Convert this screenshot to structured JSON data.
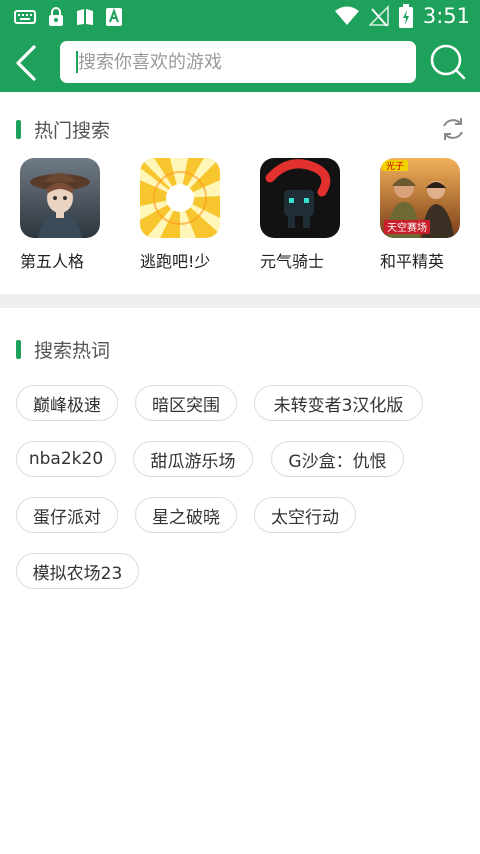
{
  "status_bar": {
    "time": "3:51",
    "left_icons": [
      "keyboard-icon",
      "lock-icon",
      "book-icon",
      "android-a-icon"
    ],
    "right_icons": [
      "wifi-icon",
      "no-signal-icon",
      "battery-charging-icon"
    ]
  },
  "header": {
    "background": "#1ea15a",
    "back_icon": "chevron-left-icon",
    "search_placeholder": "搜索你喜欢的游戏",
    "search_icon": "search-icon"
  },
  "hot_search": {
    "title": "热门搜索",
    "refresh_icon": "refresh-icon",
    "games": [
      {
        "name": "第五人格"
      },
      {
        "name": "逃跑吧!少"
      },
      {
        "name": "元气骑士"
      },
      {
        "name": "和平精英"
      }
    ]
  },
  "hot_words": {
    "title": "搜索热词",
    "tags": [
      "巅峰极速",
      "暗区突围",
      "未转变者3汉化版",
      "nba2k20",
      "甜瓜游乐场",
      "G沙盒：仇恨",
      "蛋仔派对",
      "星之破晓",
      "太空行动",
      "模拟农场23"
    ]
  },
  "game_icon_text": {
    "peace_elite_badge": "光子",
    "peace_elite_banner": "天空赛场"
  },
  "colors": {
    "accent": "#1ea15a",
    "divider": "#efefef",
    "tag_border": "#dcdcdc"
  }
}
